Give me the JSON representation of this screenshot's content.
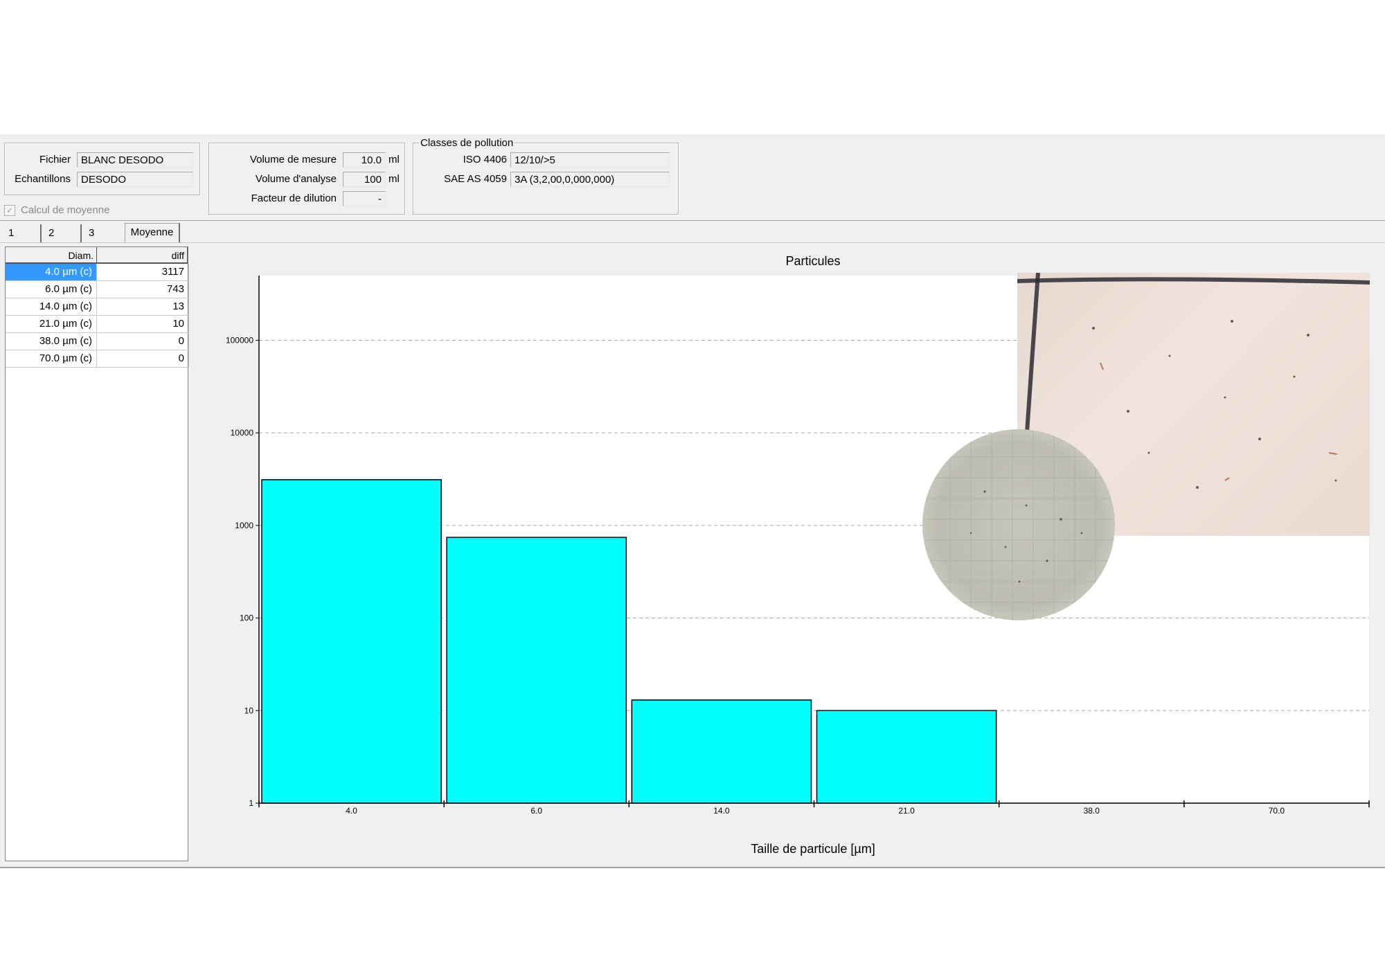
{
  "file_group": {
    "fichier_label": "Fichier",
    "fichier_value": "BLANC DESODO",
    "echantillons_label": "Echantillons",
    "echantillons_value": "DESODO"
  },
  "average_checkbox": {
    "label": "Calcul de moyenne",
    "checked": true
  },
  "volume_group": {
    "mesure_label": "Volume de mesure",
    "mesure_value": "10.0",
    "mesure_unit": "ml",
    "analyse_label": "Volume d'analyse",
    "analyse_value": "100",
    "analyse_unit": "ml",
    "dilution_label": "Facteur de dilution",
    "dilution_value": "-"
  },
  "pollution_group": {
    "title": "Classes de pollution",
    "iso_label": "ISO 4406",
    "iso_value": "12/10/>5",
    "sae_label": "SAE AS 4059",
    "sae_value": "3A (3,2,00,0,000,000)"
  },
  "tabs": [
    "1",
    "2",
    "3",
    "Moyenne"
  ],
  "table": {
    "headers": [
      "Diam.",
      "diff"
    ],
    "rows": [
      [
        "4.0 µm (c)",
        "3117"
      ],
      [
        "6.0 µm (c)",
        "743"
      ],
      [
        "14.0 µm (c)",
        "13"
      ],
      [
        "21.0 µm (c)",
        "10"
      ],
      [
        "38.0 µm (c)",
        "0"
      ],
      [
        "70.0 µm (c)",
        "0"
      ]
    ]
  },
  "colors": {
    "bar": "#00ffff",
    "selection": "#3399ff",
    "panel": "#f0f0f0"
  },
  "chart_data": {
    "type": "bar",
    "title": "Particules",
    "xlabel": "Taille de particule [µm]",
    "ylabel": "",
    "yscale": "log",
    "ylim": [
      1,
      500000
    ],
    "yticks": [
      1,
      10,
      100,
      1000,
      10000,
      100000
    ],
    "categories": [
      "4.0",
      "6.0",
      "14.0",
      "21.0",
      "38.0",
      "70.0"
    ],
    "values": [
      3117,
      743,
      13,
      10,
      0,
      0
    ],
    "grid": "horizontal-dashed"
  }
}
